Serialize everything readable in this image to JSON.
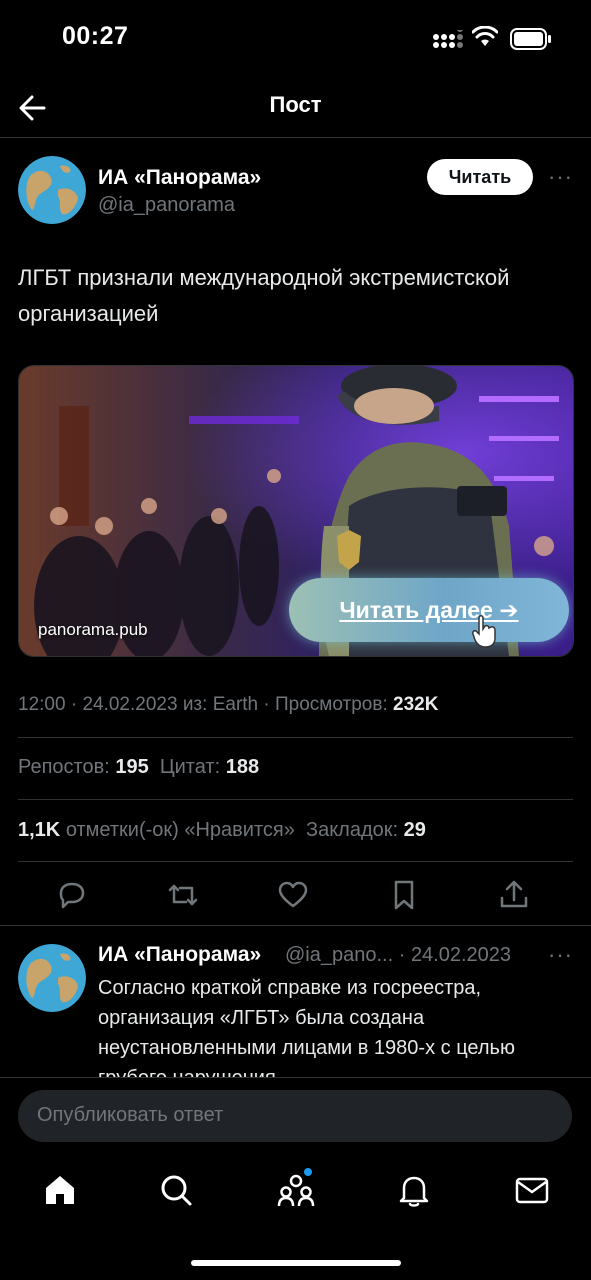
{
  "status": {
    "time": "00:27"
  },
  "header": {
    "title": "Пост"
  },
  "post": {
    "author_name": "ИА «Панорама»",
    "author_handle": "@ia_panorama",
    "follow_label": "Читать",
    "more": "···",
    "text": "ЛГБТ признали международной экстремистской организацией",
    "card": {
      "domain": "panorama.pub",
      "cta": "Читать далее ➔"
    },
    "meta": {
      "time": "12:00",
      "date": "24.02.2023",
      "from_label": "из:",
      "source": "Earth",
      "views_label": "Просмотров:",
      "views": "232K"
    },
    "stats": {
      "reposts_label": "Репостов:",
      "reposts": "195",
      "quotes_label": "Цитат:",
      "quotes": "188",
      "likes": "1,1K",
      "likes_label": "отметки(-ок) «Нравится»",
      "bookmarks_label": "Закладок:",
      "bookmarks": "29"
    }
  },
  "reply": {
    "author_name": "ИА «Панорама»",
    "author_handle": "@ia_pano...",
    "date": "24.02.2023",
    "more": "···",
    "text": "Согласно краткой справке из госреестра, организация «ЛГБТ» была создана неустановленными лицами в 1980-х с целью грубого нарушения"
  },
  "composer": {
    "placeholder": "Опубликовать ответ"
  },
  "colors": {
    "background": "#000000",
    "muted": "#71767b",
    "accent_dot": "#1d9bf0"
  }
}
